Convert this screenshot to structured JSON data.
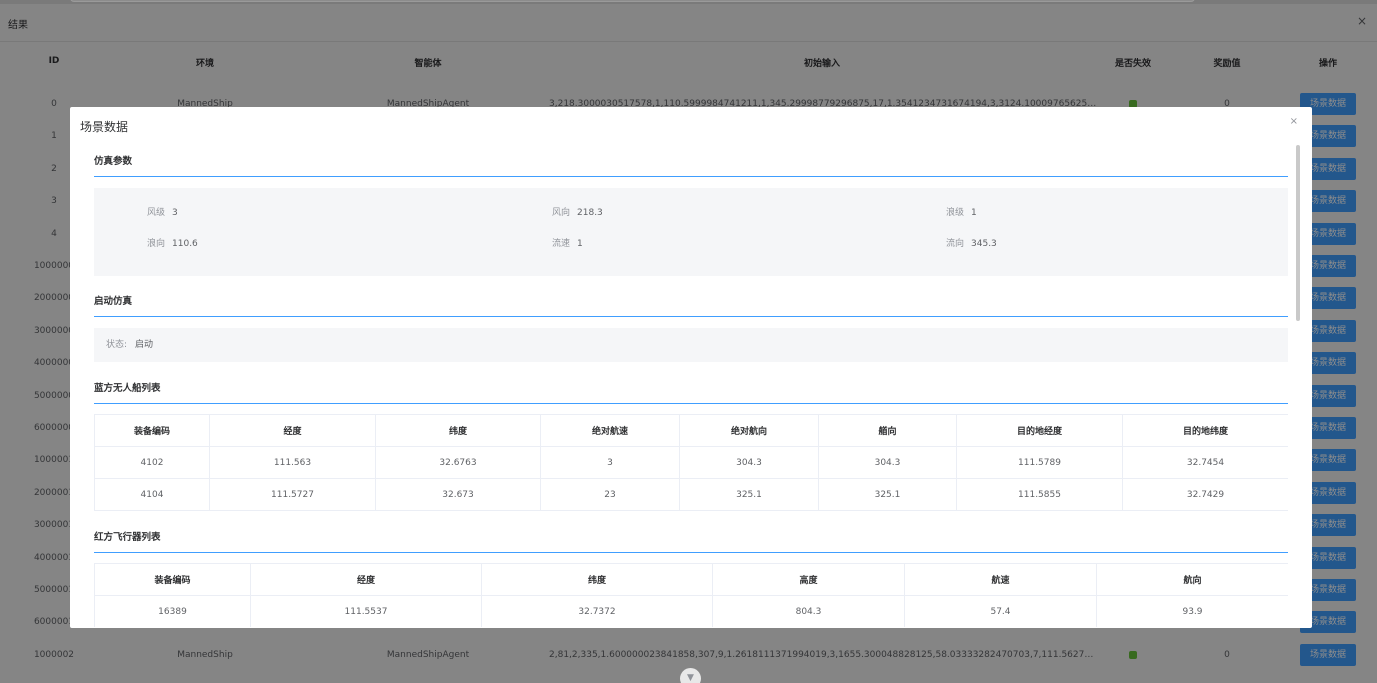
{
  "outer": {
    "title": "结果",
    "close_icon": "×",
    "headers": [
      "ID",
      "环境",
      "智能体",
      "初始输入",
      "是否失效",
      "奖励值",
      "操作"
    ],
    "rows": [
      {
        "id": "0",
        "env": "MannedShip",
        "agent": "MannedShipAgent",
        "input": "3,218.3000030517578,1,110.5999984741211,1,345.29998779296875,17,1.3541234731674194,3,3124.10009765625,72.3333",
        "reward": "0",
        "action": "场景数据"
      },
      {
        "id": "1",
        "env": "",
        "agent": "",
        "input": "",
        "reward": "",
        "action": "场景数据"
      },
      {
        "id": "2",
        "env": "",
        "agent": "",
        "input": "",
        "reward": "",
        "action": "场景数据"
      },
      {
        "id": "3",
        "env": "",
        "agent": "",
        "input": "",
        "reward": "",
        "action": "场景数据"
      },
      {
        "id": "4",
        "env": "",
        "agent": "",
        "input": "",
        "reward": "",
        "action": "场景数据"
      },
      {
        "id": "1000000",
        "env": "",
        "agent": "",
        "input": "",
        "reward": "",
        "action": "场景数据"
      },
      {
        "id": "2000000",
        "env": "",
        "agent": "",
        "input": "",
        "reward": "",
        "action": "场景数据"
      },
      {
        "id": "3000000",
        "env": "",
        "agent": "",
        "input": "",
        "reward": "",
        "action": "场景数据"
      },
      {
        "id": "4000000",
        "env": "",
        "agent": "",
        "input": "",
        "reward": "",
        "action": "场景数据"
      },
      {
        "id": "5000000",
        "env": "",
        "agent": "",
        "input": "",
        "reward": "",
        "action": "场景数据"
      },
      {
        "id": "6000000",
        "env": "",
        "agent": "",
        "input": "",
        "reward": "",
        "action": "场景数据"
      },
      {
        "id": "1000001",
        "env": "",
        "agent": "",
        "input": "",
        "reward": "",
        "action": "场景数据"
      },
      {
        "id": "2000001",
        "env": "",
        "agent": "",
        "input": "",
        "reward": "",
        "action": "场景数据"
      },
      {
        "id": "3000001",
        "env": "",
        "agent": "",
        "input": "",
        "reward": "",
        "action": "场景数据"
      },
      {
        "id": "4000001",
        "env": "",
        "agent": "",
        "input": "",
        "reward": "",
        "action": "场景数据"
      },
      {
        "id": "5000001",
        "env": "",
        "agent": "",
        "input": "",
        "reward": "",
        "action": "场景数据"
      },
      {
        "id": "6000001",
        "env": "",
        "agent": "",
        "input": "",
        "reward": "",
        "action": "场景数据"
      },
      {
        "id": "1000002",
        "env": "MannedShip",
        "agent": "MannedShipAgent",
        "input": "2,81,2,335,1.600000023841858,307,9,1.2618111371994019,3,1655.300048828125,58.03333282470703,7,111.562759399414...",
        "reward": "0",
        "action": "场景数据"
      }
    ],
    "scroll_icon": "▼"
  },
  "modal": {
    "title": "场景数据",
    "close_icon": "×",
    "sim_params": {
      "title": "仿真参数",
      "items": [
        {
          "label": "风级",
          "value": "3"
        },
        {
          "label": "风向",
          "value": "218.3"
        },
        {
          "label": "浪级",
          "value": "1"
        },
        {
          "label": "浪向",
          "value": "110.6"
        },
        {
          "label": "流速",
          "value": "1"
        },
        {
          "label": "流向",
          "value": "345.3"
        }
      ]
    },
    "start_sim": {
      "title": "启动仿真",
      "status_label": "状态:",
      "status_value": "启动"
    },
    "blue_table": {
      "title": "蓝方无人船列表",
      "headers": [
        "装备编码",
        "经度",
        "纬度",
        "绝对航速",
        "绝对航向",
        "艏向",
        "目的地经度",
        "目的地纬度"
      ],
      "rows": [
        [
          "4102",
          "111.563",
          "32.6763",
          "3",
          "304.3",
          "304.3",
          "111.5789",
          "32.7454"
        ],
        [
          "4104",
          "111.5727",
          "32.673",
          "23",
          "325.1",
          "325.1",
          "111.5855",
          "32.7429"
        ]
      ]
    },
    "red_table": {
      "title": "红方飞行器列表",
      "headers": [
        "装备编码",
        "经度",
        "纬度",
        "高度",
        "航速",
        "航向"
      ],
      "rows": [
        [
          "16389",
          "111.5537",
          "32.7372",
          "804.3",
          "57.4",
          "93.9"
        ]
      ]
    }
  },
  "colors": {
    "accent": "#409eff",
    "valid_dot": "#67c23a"
  }
}
